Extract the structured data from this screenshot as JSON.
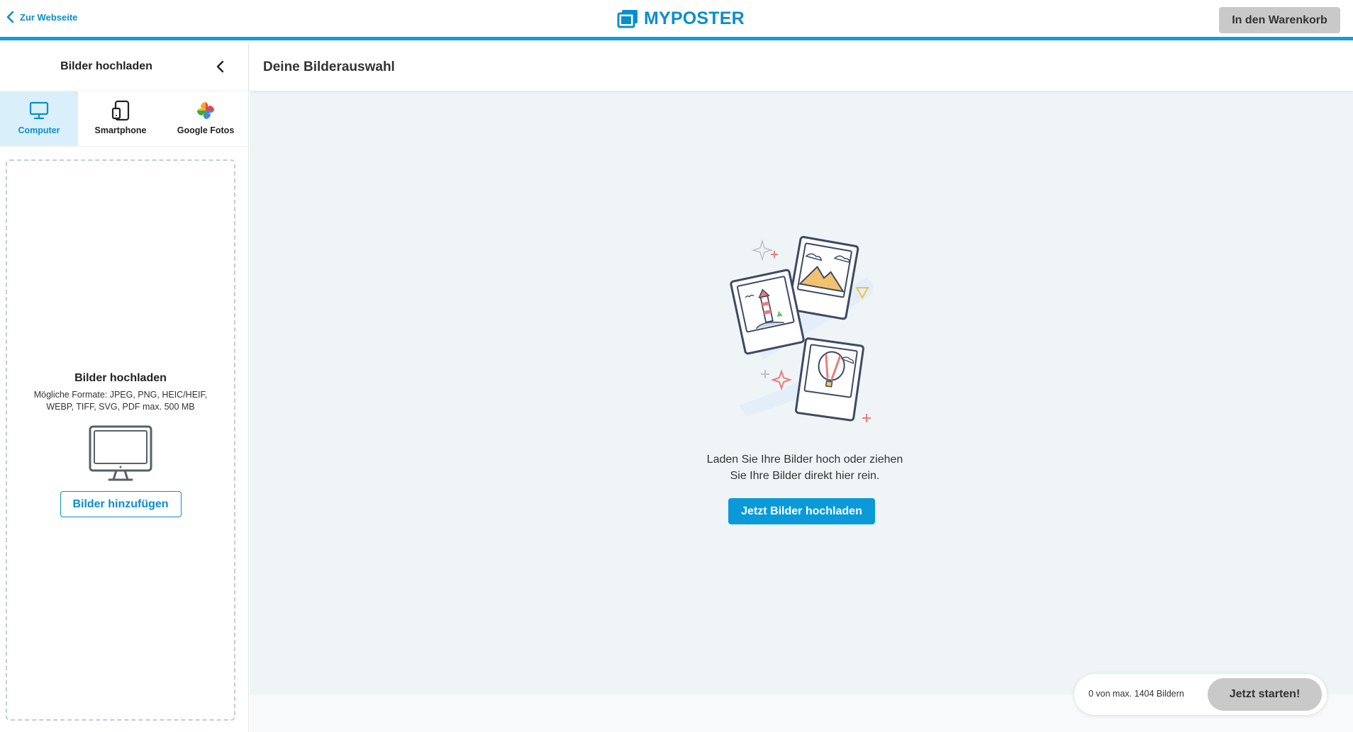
{
  "topbar": {
    "back_label": "Zur Webseite",
    "logo_text": "MYPOSTER",
    "cart_label": "In den Warenkorb",
    "accent": "#0f9fd8"
  },
  "sidebar": {
    "title": "Bilder hochladen",
    "tabs": [
      {
        "label": "Computer",
        "icon": "monitor-icon",
        "active": true
      },
      {
        "label": "Smartphone",
        "icon": "smartphone-icon",
        "active": false
      },
      {
        "label": "Google Fotos",
        "icon": "google-photos-icon",
        "active": false
      }
    ],
    "dropzone": {
      "title": "Bilder hochladen",
      "formats": "Mögliche Formate: JPEG, PNG, HEIC/HEIF, WEBP, TIFF, SVG, PDF max. 500 MB",
      "button_label": "Bilder hinzufügen"
    }
  },
  "main": {
    "title": "Deine Bilderauswahl",
    "empty_text_line1": "Laden Sie Ihre Bilder hoch oder ziehen",
    "empty_text_line2": "Sie Ihre Bilder direkt hier rein.",
    "upload_button": "Jetzt Bilder hochladen"
  },
  "counter": {
    "text": "0 von max. 1404 Bildern",
    "start_button": "Jetzt starten!"
  }
}
